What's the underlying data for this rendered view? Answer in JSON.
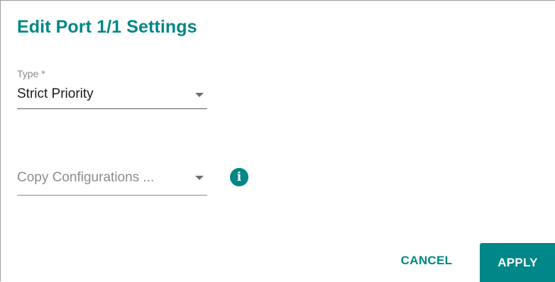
{
  "dialog": {
    "title": "Edit Port 1/1 Settings"
  },
  "type_field": {
    "label": "Type *",
    "value": "Strict Priority"
  },
  "copy_field": {
    "placeholder": "Copy Configurations ...",
    "info_icon": "info-icon",
    "info_glyph": "i"
  },
  "actions": {
    "cancel_label": "CANCEL",
    "apply_label": "APPLY"
  },
  "colors": {
    "accent": "#008787",
    "text_primary": "#1c1c1c",
    "text_secondary": "#8a8a8a"
  }
}
